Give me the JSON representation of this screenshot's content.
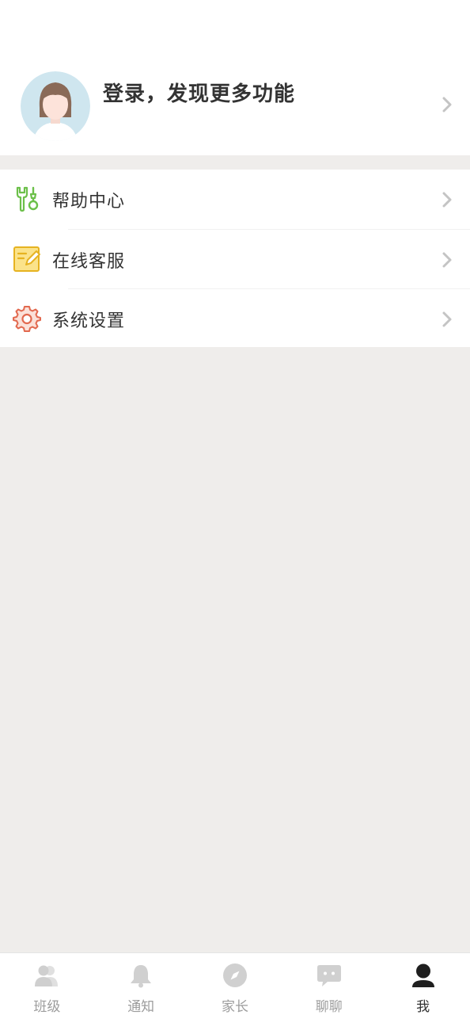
{
  "profile": {
    "prompt": "登录，发现更多功能",
    "avatar_icon": "user-avatar",
    "avatar_bg": "#cfe6ef"
  },
  "menu": [
    {
      "label": "帮助中心",
      "icon": "wrench-icon",
      "color": "#6cc04a"
    },
    {
      "label": "在线客服",
      "icon": "note-edit-icon",
      "color": "#f3c63f"
    },
    {
      "label": "系统设置",
      "icon": "gear-icon",
      "color": "#e2694f"
    }
  ],
  "tabbar": {
    "items": [
      {
        "label": "班级",
        "icon": "people-icon"
      },
      {
        "label": "通知",
        "icon": "bell-icon"
      },
      {
        "label": "家长",
        "icon": "compass-icon"
      },
      {
        "label": "聊聊",
        "icon": "chat-icon"
      },
      {
        "label": "我",
        "icon": "person-icon"
      }
    ],
    "active_index": 4,
    "active_color": "#333333",
    "inactive_color": "#c8c8c8"
  }
}
